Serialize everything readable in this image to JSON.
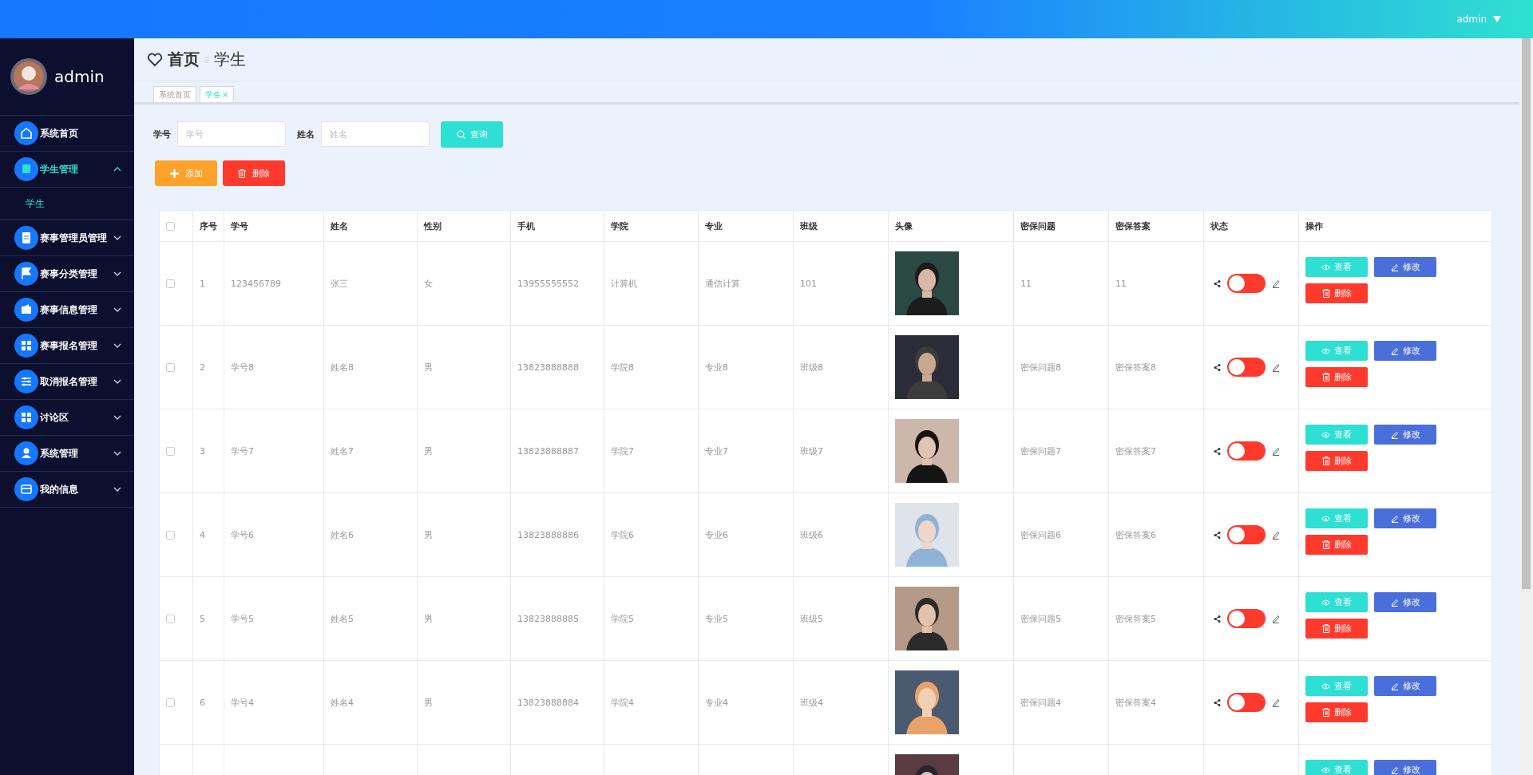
{
  "topbar": {
    "user": "admin"
  },
  "sidebar": {
    "user": "admin",
    "items": [
      {
        "kind": "link",
        "label": "系统首页",
        "selected": false
      },
      {
        "kind": "menu",
        "label": "学生管理",
        "selected": true,
        "expanded": true,
        "children": [
          {
            "label": "学生",
            "selected": true
          }
        ]
      },
      {
        "kind": "menu",
        "label": "赛事管理员管理",
        "selected": false,
        "expanded": false
      },
      {
        "kind": "menu",
        "label": "赛事分类管理",
        "selected": false,
        "expanded": false
      },
      {
        "kind": "menu",
        "label": "赛事信息管理",
        "selected": false,
        "expanded": false
      },
      {
        "kind": "menu",
        "label": "赛事报名管理",
        "selected": false,
        "expanded": false
      },
      {
        "kind": "menu",
        "label": "取消报名管理",
        "selected": false,
        "expanded": false
      },
      {
        "kind": "menu",
        "label": "讨论区",
        "selected": false,
        "expanded": false
      },
      {
        "kind": "menu",
        "label": "系统管理",
        "selected": false,
        "expanded": false
      },
      {
        "kind": "menu",
        "label": "我的信息",
        "selected": false,
        "expanded": false
      }
    ]
  },
  "breadcrumb": {
    "home": "首页",
    "current": "学生"
  },
  "tabs": [
    {
      "label": "系统首页",
      "selected": false
    },
    {
      "label": "学生",
      "selected": true,
      "close": "×"
    }
  ],
  "search": {
    "fields": [
      {
        "label": "学号",
        "placeholder": "学号"
      },
      {
        "label": "姓名",
        "placeholder": "姓名"
      }
    ],
    "button": "查询"
  },
  "actions": {
    "add": "添加",
    "delete": "删除"
  },
  "table": {
    "all_checked": false,
    "columns": [
      "序号",
      "学号",
      "姓名",
      "性别",
      "手机",
      "学院",
      "专业",
      "班级",
      "头像",
      "密保问题",
      "密保答案",
      "状态",
      "操作"
    ],
    "rows": [
      {
        "checked": false,
        "cells": [
          "1",
          "123456789",
          "张三",
          "女",
          "13955555552",
          "计算机",
          "通信计算",
          "101"
        ],
        "question": "11",
        "answer": "11",
        "on": false,
        "actions": [
          {
            "kind": "view",
            "label": "查看"
          },
          {
            "kind": "edit",
            "label": "修改"
          },
          {
            "kind": "delete",
            "label": "删除"
          }
        ]
      },
      {
        "checked": false,
        "cells": [
          "2",
          "学号8",
          "姓名8",
          "男",
          "13823888888",
          "学院8",
          "专业8",
          "班级8"
        ],
        "question": "密保问题8",
        "answer": "密保答案8",
        "on": false,
        "actions": [
          {
            "kind": "view",
            "label": "查看"
          },
          {
            "kind": "edit",
            "label": "修改"
          },
          {
            "kind": "delete",
            "label": "删除"
          }
        ]
      },
      {
        "checked": false,
        "cells": [
          "3",
          "学号7",
          "姓名7",
          "男",
          "13823888887",
          "学院7",
          "专业7",
          "班级7"
        ],
        "question": "密保问题7",
        "answer": "密保答案7",
        "on": false,
        "actions": [
          {
            "kind": "view",
            "label": "查看"
          },
          {
            "kind": "edit",
            "label": "修改"
          },
          {
            "kind": "delete",
            "label": "删除"
          }
        ]
      },
      {
        "checked": false,
        "cells": [
          "4",
          "学号6",
          "姓名6",
          "男",
          "13823888886",
          "学院6",
          "专业6",
          "班级6"
        ],
        "question": "密保问题6",
        "answer": "密保答案6",
        "on": false,
        "actions": [
          {
            "kind": "view",
            "label": "查看"
          },
          {
            "kind": "edit",
            "label": "修改"
          },
          {
            "kind": "delete",
            "label": "删除"
          }
        ]
      },
      {
        "checked": false,
        "cells": [
          "5",
          "学号5",
          "姓名5",
          "男",
          "13823888885",
          "学院5",
          "专业5",
          "班级5"
        ],
        "question": "密保问题5",
        "answer": "密保答案5",
        "on": false,
        "actions": [
          {
            "kind": "view",
            "label": "查看"
          },
          {
            "kind": "edit",
            "label": "修改"
          },
          {
            "kind": "delete",
            "label": "删除"
          }
        ]
      },
      {
        "checked": false,
        "cells": [
          "6",
          "学号4",
          "姓名4",
          "男",
          "13823888884",
          "学院4",
          "专业4",
          "班级4"
        ],
        "question": "密保问题4",
        "answer": "密保答案4",
        "on": false,
        "actions": [
          {
            "kind": "view",
            "label": "查看"
          },
          {
            "kind": "edit",
            "label": "修改"
          },
          {
            "kind": "delete",
            "label": "删除"
          }
        ]
      },
      {
        "cells": [],
        "actions": [
          {
            "kind": "view",
            "label": "查看"
          },
          {
            "kind": "edit",
            "label": "修改"
          }
        ]
      }
    ]
  }
}
